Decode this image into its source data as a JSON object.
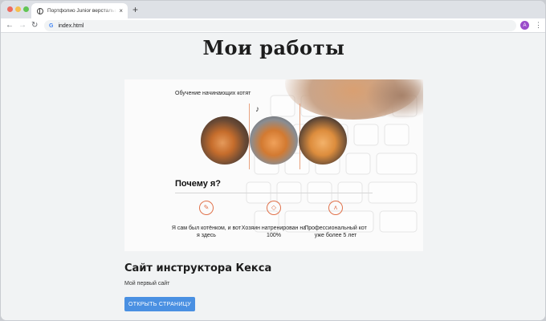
{
  "browser": {
    "tab_title": "Портфолио Junior верстальщика",
    "tab_close": "×",
    "new_tab": "+",
    "back": "←",
    "forward": "→",
    "reload": "↻",
    "url": "index.html",
    "profile_initial": "A",
    "menu": "⋮"
  },
  "page": {
    "title": "Мои работы",
    "project": {
      "preview": {
        "kicker": "Обучение начинающих котят",
        "heading": "Почему я?",
        "features": [
          {
            "icon": "paw-icon",
            "text": "Я сам был котёнком, и вот я здесь"
          },
          {
            "icon": "fish-icon",
            "text": "Хозяин натренирован на 100%"
          },
          {
            "icon": "cat-face-icon",
            "text": "Профессиональный кот уже более 5 лет"
          }
        ]
      },
      "title": "Сайт инструктора Кекса",
      "subtitle": "Мой первый сайт",
      "button_label": "ОТКРЫТЬ СТРАНИЦУ"
    }
  },
  "colors": {
    "accent_button": "#4a90e2",
    "feature_icon": "#e0714a"
  }
}
